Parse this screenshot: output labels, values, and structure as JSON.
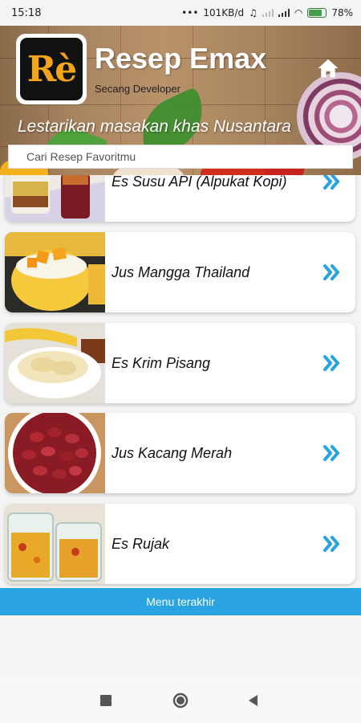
{
  "status_bar": {
    "time": "15:18",
    "network_speed": "101KB/d",
    "battery": "78%"
  },
  "header": {
    "logo_text": "Rè",
    "title": "Resep Emax",
    "developer": "Secang Developer",
    "tagline": "Lestarikan masakan khas Nusantara",
    "home_icon": "home-icon"
  },
  "search": {
    "placeholder": "Cari Resep Favoritmu"
  },
  "recipes": [
    {
      "title": "Es Susu API (Alpukat Kopi)",
      "thumb": "avocado-coffee-drink"
    },
    {
      "title": "Jus Mangga Thailand",
      "thumb": "mango-juice"
    },
    {
      "title": "Es Krim Pisang",
      "thumb": "banana-ice-cream"
    },
    {
      "title": "Jus Kacang Merah",
      "thumb": "red-beans"
    },
    {
      "title": "Es Rujak",
      "thumb": "fruit-salad-ice"
    }
  ],
  "menu_bar": {
    "label": "Menu terakhir"
  },
  "nav": {
    "recent": "square-icon",
    "home": "circle-icon",
    "back": "triangle-icon"
  },
  "colors": {
    "accent": "#29a3e1",
    "logo": "#f2a51a"
  }
}
